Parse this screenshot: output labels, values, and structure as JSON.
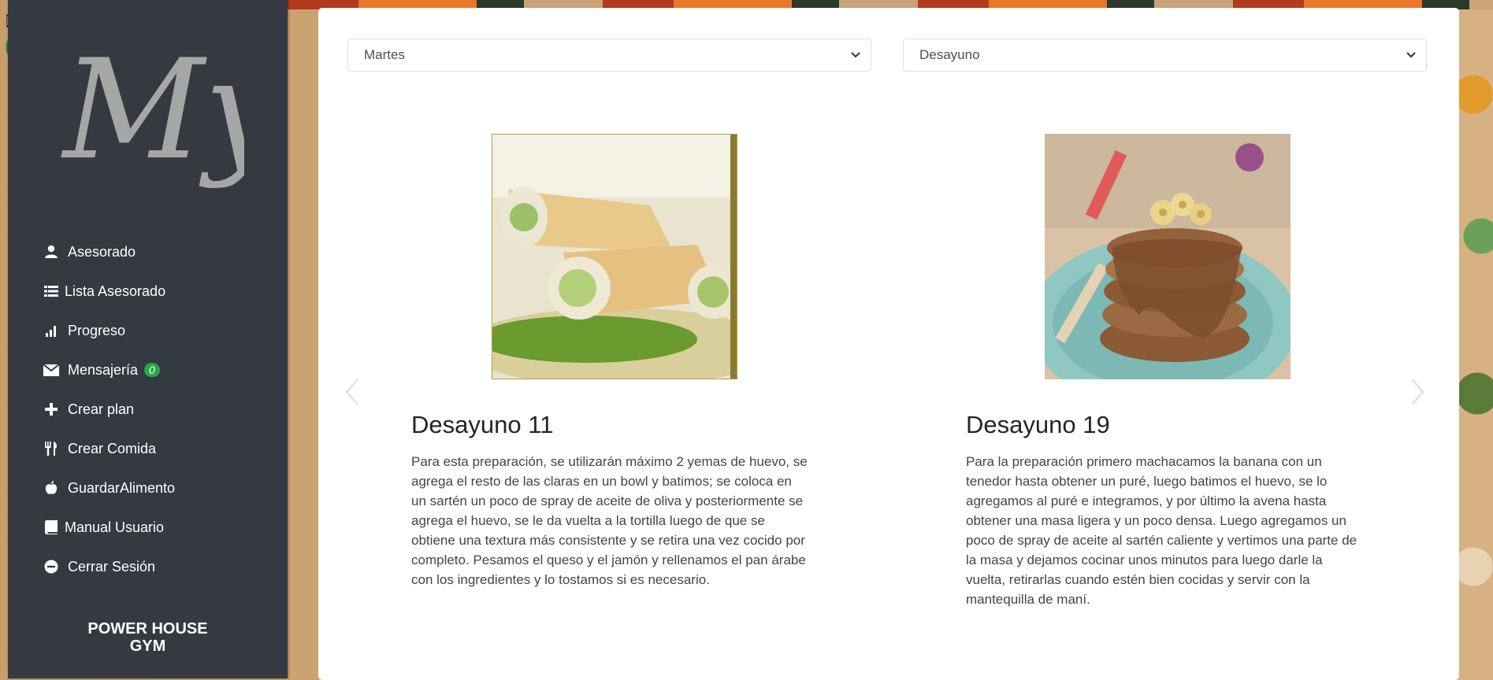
{
  "colors": {
    "sidebar_bg": "#343a40",
    "badge_bg": "#28a745",
    "card_bg": "#ffffff"
  },
  "sidebar": {
    "logo_text": "My",
    "items": [
      {
        "label": "Asesorado",
        "icon": "user-icon"
      },
      {
        "label": "Lista Asesorado",
        "icon": "list-icon"
      },
      {
        "label": "Progreso",
        "icon": "bar-chart-icon"
      },
      {
        "label": "Mensajería",
        "icon": "envelope-icon",
        "badge": "0"
      },
      {
        "label": "Crear plan",
        "icon": "plus-icon"
      },
      {
        "label": "Crear Comida",
        "icon": "cutlery-icon"
      },
      {
        "label": "GuardarAlimento",
        "icon": "apple-icon"
      },
      {
        "label": "Manual Usuario",
        "icon": "book-icon"
      },
      {
        "label": "Cerrar Sesión",
        "icon": "minus-circle-icon"
      }
    ],
    "brand_line1": "POWER HOUSE",
    "brand_line2": "GYM"
  },
  "filters": {
    "day_selected": "Martes",
    "meal_selected": "Desayuno"
  },
  "meals": [
    {
      "title": "Desayuno 11",
      "description": "Para esta preparación, se utilizarán máximo 2 yemas de huevo, se agrega el resto de las claras en un bowl y batimos; se coloca en un sartén un poco de spray de aceite de oliva y posteriormente se agrega el huevo, se le da vuelta a la tortilla luego de que se obtiene una textura más consistente y se retira una vez cocido por completo. Pesamos el queso y el jamón y rellenamos el pan árabe con los ingredientes y lo tostamos si es necesario.",
      "image": "wraps-photo"
    },
    {
      "title": "Desayuno 19",
      "description": "Para la preparación primero machacamos la banana con un tenedor hasta obtener un puré, luego batimos el huevo, se lo agregamos al puré e integramos, y por último la avena hasta obtener una masa ligera y un poco densa. Luego agregamos un poco de spray de aceite al sartén caliente y vertimos una parte de la masa y dejamos cocinar unos minutos para luego darle la vuelta, retirarlas cuando estén bien cocidas y servir con la mantequilla de maní.",
      "image": "pancakes-photo"
    }
  ]
}
